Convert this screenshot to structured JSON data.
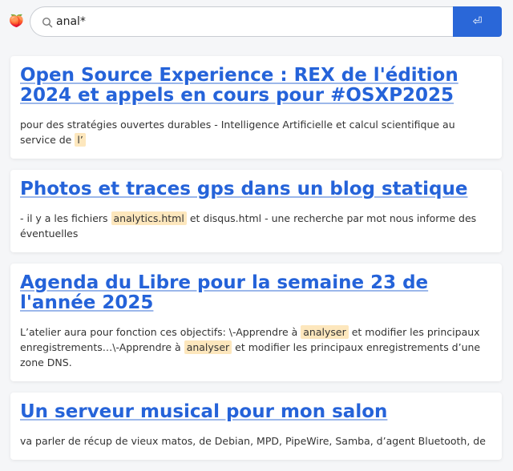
{
  "search": {
    "query": "anal*",
    "logo_glyph": "🍑",
    "submit_glyph": "⏎"
  },
  "results": [
    {
      "title": "Open Source Experience : REX de l'édition 2024 et appels en cours pour #OSXP2025",
      "snippet": [
        {
          "text": "pour des stratégies ouvertes durables - Intelligence Artificielle et calcul scientifique au service de "
        },
        {
          "text": "l’",
          "hl": true
        }
      ]
    },
    {
      "title": "Photos et traces gps dans un blog statique",
      "snippet": [
        {
          "text": "- il y a les fichiers "
        },
        {
          "text": "analytics.html",
          "hl": true
        },
        {
          "text": " et disqus.html - une recherche par mot nous informe des éventuelles"
        }
      ]
    },
    {
      "title": "Agenda du Libre pour la semaine 23 de l'année 2025",
      "snippet": [
        {
          "text": "L’atelier aura pour fonction ces objectifs: \\-Apprendre à "
        },
        {
          "text": "analyser",
          "hl": true
        },
        {
          "text": " et modifier les principaux enregistrements…\\-Apprendre à "
        },
        {
          "text": "analyser",
          "hl": true
        },
        {
          "text": " et modifier les principaux enregistrements d’une zone DNS."
        }
      ]
    },
    {
      "title": "Un serveur musical pour mon salon",
      "snippet": [
        {
          "text": "va parler de récup de vieux matos, de Debian, MPD, PipeWire, Samba, d’agent Bluetooth, de "
        }
      ]
    }
  ]
}
